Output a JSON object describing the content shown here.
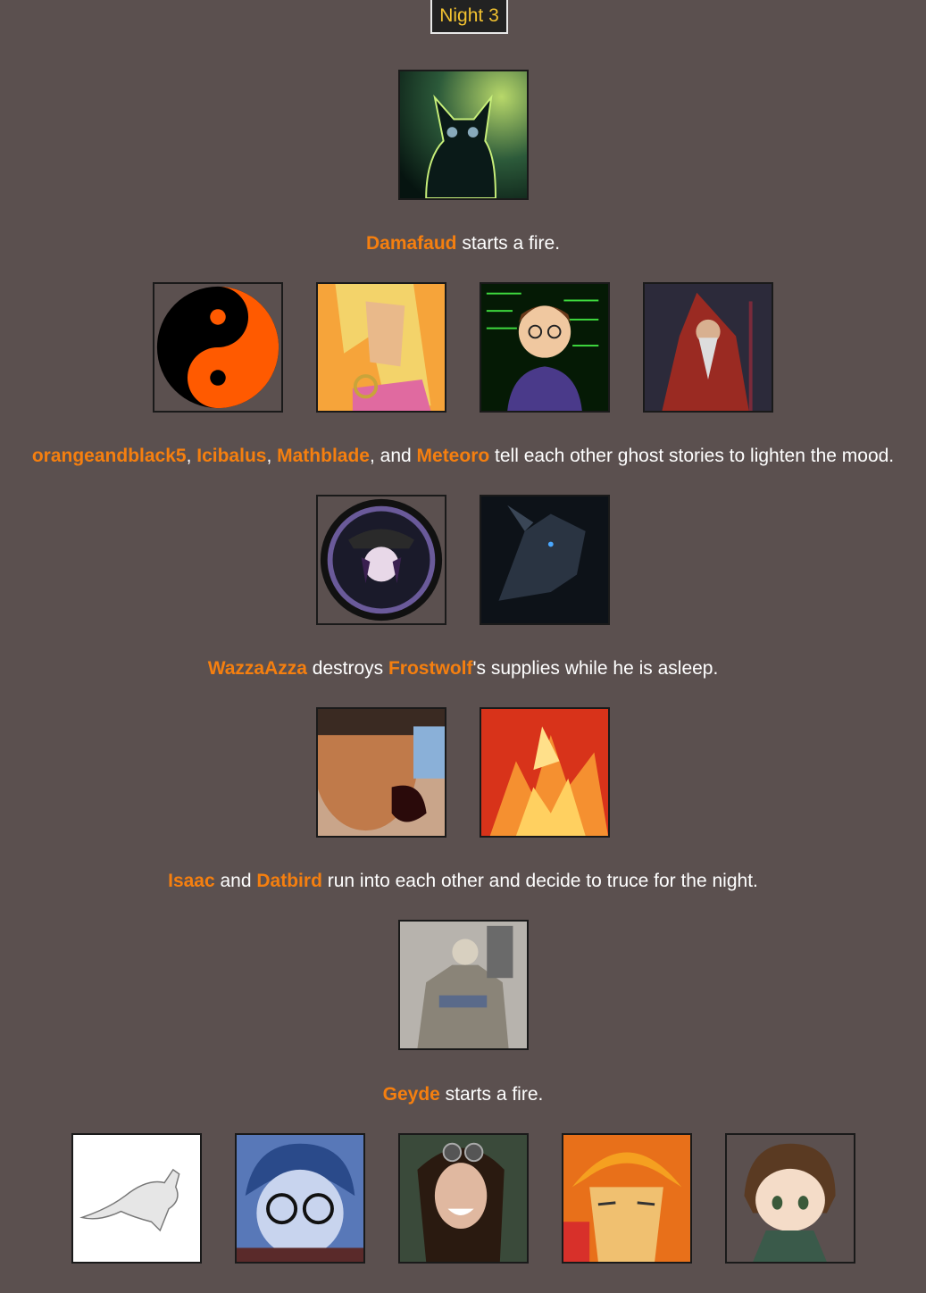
{
  "header": {
    "label": "Night 3"
  },
  "events": [
    {
      "players": [
        "Damafaud"
      ],
      "text": [
        "",
        "Damafaud",
        " starts a fire."
      ]
    },
    {
      "players": [
        "orangeandblack5",
        "Icibalus",
        "Mathblade",
        "Meteoro"
      ],
      "text": [
        "",
        "orangeandblack5",
        ", ",
        "Icibalus",
        ", ",
        "Mathblade",
        ", and ",
        "Meteoro",
        " tell each other ghost stories to lighten the mood."
      ]
    },
    {
      "players": [
        "WazzaAzza",
        "Frostwolf"
      ],
      "text": [
        "",
        "WazzaAzza",
        " destroys ",
        "Frostwolf",
        "'s supplies while he is asleep."
      ]
    },
    {
      "players": [
        "Isaac",
        "Datbird"
      ],
      "text": [
        "",
        "Isaac",
        " and ",
        "Datbird",
        " run into each other and decide to truce for the night."
      ]
    },
    {
      "players": [
        "Geyde"
      ],
      "text": [
        "",
        "Geyde",
        " starts a fire."
      ]
    }
  ],
  "avatars": {
    "a1": "cat-avatar",
    "a2": "yin-yang-avatar",
    "a3": "blonde-anime-avatar",
    "a4": "programmer-avatar",
    "a5": "wizard-avatar",
    "a6": "soldier-anime-avatar",
    "a7": "dark-dragon-avatar",
    "a8": "shouting-face-avatar",
    "a9": "fire-bird-avatar",
    "a10": "muscle-stand-avatar",
    "a11": "kangaroo-sketch-avatar",
    "a12": "glasses-boy-avatar",
    "a13": "goggles-woman-avatar",
    "a14": "orange-hat-avatar",
    "a15": "chibi-avatar"
  },
  "colors": {
    "background": "#5b504f",
    "name": "#f57f0f",
    "badge_text": "#f2c230"
  }
}
